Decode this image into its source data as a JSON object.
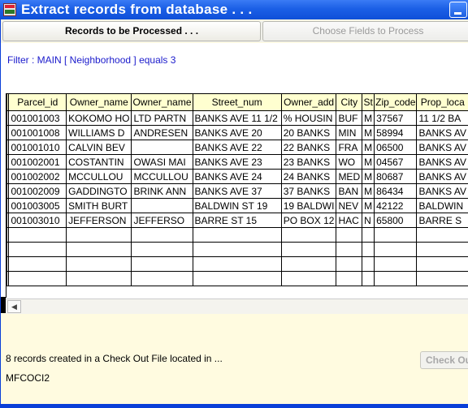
{
  "window": {
    "title": "Extract records from database . . ."
  },
  "tabs": [
    {
      "label": "Records to be Processed . . ."
    },
    {
      "label": "Choose Fields to Process"
    }
  ],
  "filter": "Filter : MAIN [ Neighborhood ] equals 3",
  "grid": {
    "columns": [
      "Parcel_id",
      "Owner_name",
      "Owner_name",
      "Street_num",
      "Owner_add",
      "City",
      "St",
      "Zip_code",
      "Prop_loca"
    ],
    "rows": [
      [
        "001001003",
        "KOKOMO HO",
        "LTD PARTN",
        "BANKS AVE    11 1/2",
        "% HOUSIN",
        "BUF",
        "M",
        "37567",
        "11 1/2 BA"
      ],
      [
        "001001008",
        "WILLIAMS D",
        "ANDRESEN",
        "BANKS AVE    20",
        "20 BANKS",
        "MIN",
        "M",
        "58994",
        "BANKS AV"
      ],
      [
        "001001010",
        "CALVIN BEV",
        "",
        "BANKS AVE    22",
        "22 BANKS",
        "FRA",
        "M",
        "06500",
        "BANKS AV"
      ],
      [
        "001002001",
        "COSTANTIN",
        "OWASI MAI",
        "BANKS AVE    23",
        "23 BANKS",
        "WO",
        "M",
        "04567",
        "BANKS AV"
      ],
      [
        "001002002",
        "MCCULLOU",
        "MCCULLOU",
        "BANKS AVE    24",
        "24 BANKS",
        "MED",
        "M",
        "80687",
        "BANKS AV"
      ],
      [
        "001002009",
        "GADDINGTO",
        "BRINK ANN",
        "BANKS AVE    37",
        "37 BANKS",
        "BAN",
        "M",
        "86434",
        "BANKS AV"
      ],
      [
        "001003005",
        "SMITH BURT",
        "",
        "BALDWIN ST    19",
        "19 BALDWI",
        "NEV",
        "M",
        "42122",
        "BALDWIN"
      ],
      [
        "001003010",
        "JEFFERSON",
        "JEFFERSO",
        "BARRE ST    15",
        "PO BOX 12",
        "HAC",
        "N",
        "65800",
        "BARRE S"
      ]
    ]
  },
  "status": "8 records created in a Check Out File located in ...",
  "filename": "MFCOCI2",
  "checkout_button": "Check Out"
}
